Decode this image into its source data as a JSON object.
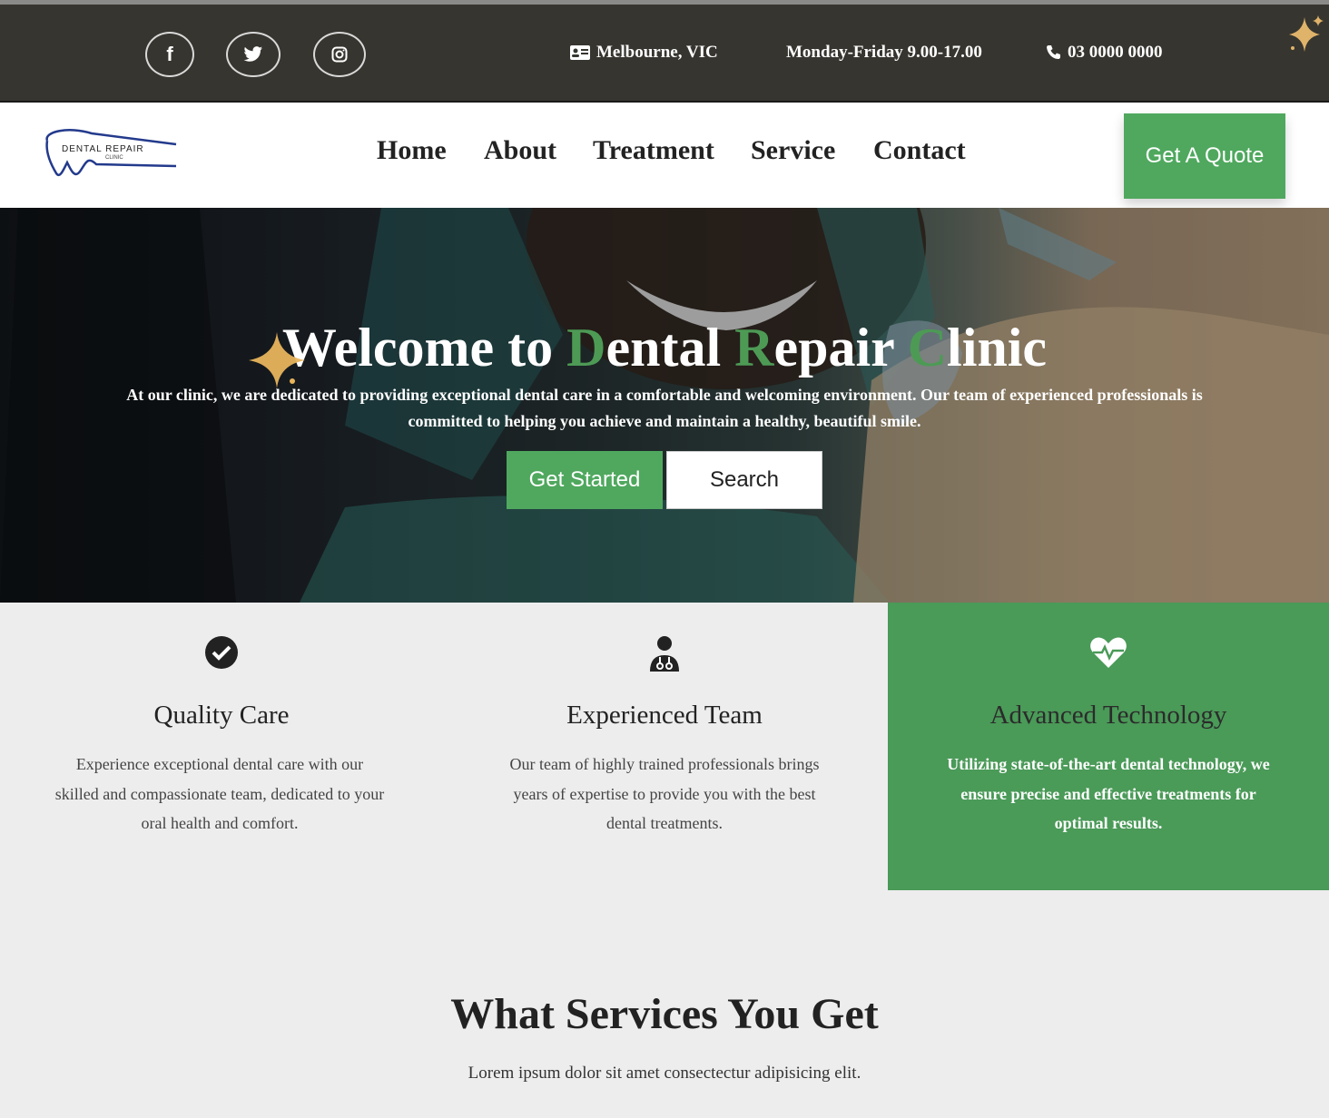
{
  "topbar": {
    "social": [
      {
        "icon": "facebook-icon",
        "glyph": "f"
      },
      {
        "icon": "twitter-icon",
        "glyph": ""
      },
      {
        "icon": "instagram-icon",
        "glyph": ""
      }
    ],
    "location": "Melbourne, VIC",
    "hours": "Monday-Friday 9.00-17.00",
    "phone": "03 0000 0000"
  },
  "logo": {
    "text": "DENTAL REPAIR",
    "subtext": "CLINIC"
  },
  "nav": {
    "items": [
      "Home",
      "About",
      "Treatment",
      "Service",
      "Contact"
    ],
    "quote_label": "Get A Quote"
  },
  "hero": {
    "title_parts": [
      "Welcome to ",
      "D",
      "ental ",
      "R",
      "epair ",
      "C",
      "linic"
    ],
    "text": "At our clinic, we are dedicated to providing exceptional dental care in a comfortable and welcoming environment. Our team of experienced professionals is committed to helping you achieve and maintain a healthy, beautiful smile.",
    "primary_button": "Get Started",
    "secondary_button": "Search"
  },
  "features": [
    {
      "icon": "check-circle-icon",
      "title": "Quality Care",
      "text": "Experience exceptional dental care with our skilled and compassionate team, dedicated to your oral health and comfort."
    },
    {
      "icon": "doctor-icon",
      "title": "Experienced Team",
      "text": "Our team of highly trained professionals brings years of expertise to provide you with the best dental treatments."
    },
    {
      "icon": "heartbeat-icon",
      "title": "Advanced Technology",
      "text": "Utilizing state-of-the-art dental technology, we ensure precise and effective treatments for optimal results."
    }
  ],
  "services": {
    "title": "What Services You Get",
    "subtitle": "Lorem ipsum dolor sit amet consectectur adipisicing elit."
  },
  "colors": {
    "accent": "#4fa85e",
    "topbar": "#37352f",
    "feature_active": "#4a9a58"
  }
}
